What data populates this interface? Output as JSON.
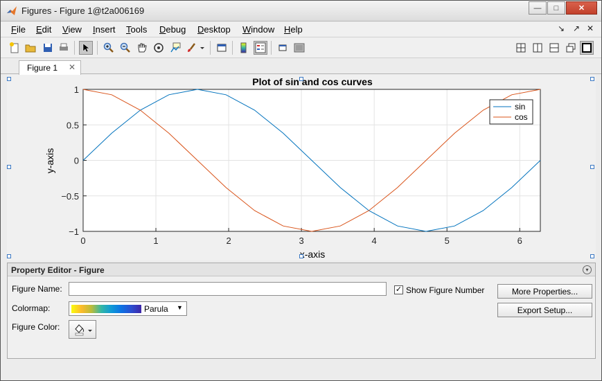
{
  "window": {
    "title": "Figures - Figure 1@t2a006169",
    "controls": {
      "minimize": "—",
      "maximize": "□",
      "close": "✕"
    }
  },
  "menu": {
    "items": [
      {
        "label": "File",
        "key": "F",
        "rest": "ile"
      },
      {
        "label": "Edit",
        "key": "E",
        "rest": "dit"
      },
      {
        "label": "View",
        "key": "V",
        "rest": "iew"
      },
      {
        "label": "Insert",
        "key": "I",
        "rest": "nsert"
      },
      {
        "label": "Tools",
        "key": "T",
        "rest": "ools"
      },
      {
        "label": "Debug",
        "key": "D",
        "rest": "ebug"
      },
      {
        "label": "Desktop",
        "key": "D",
        "rest": "esktop"
      },
      {
        "label": "Window",
        "key": "W",
        "rest": "indow"
      },
      {
        "label": "Help",
        "key": "H",
        "rest": "elp"
      }
    ],
    "right_icons": [
      "↘",
      "↗",
      "✕"
    ]
  },
  "toolbar": {
    "icons": [
      "new-figure-icon",
      "open-icon",
      "save-icon",
      "print-icon",
      "edit-plot-icon",
      "zoom-in-icon",
      "zoom-out-icon",
      "pan-icon",
      "rotate-3d-icon",
      "data-cursor-icon",
      "brush-icon",
      "link-plot-icon",
      "colorbar-icon",
      "legend-icon",
      "hide-plot-tools-icon",
      "show-plot-tools-icon",
      "tile-icon",
      "left-right-icon",
      "top-bottom-icon",
      "float-icon",
      "maximize-icon"
    ]
  },
  "tabs": [
    {
      "label": "Figure 1",
      "close": "✕"
    }
  ],
  "chart_data": {
    "type": "line",
    "title": "Plot of sin and cos curves",
    "xlabel": "x-axis",
    "ylabel": "y-axis",
    "xlim": [
      0,
      6.2832
    ],
    "ylim": [
      -1,
      1
    ],
    "xticks": [
      "0",
      "1",
      "2",
      "3",
      "4",
      "5",
      "6"
    ],
    "yticks": [
      "1",
      "0.5",
      "0",
      "−0.5",
      "−1"
    ],
    "grid": true,
    "legend": "top-right",
    "x": [
      0,
      0.3927,
      0.7854,
      1.1781,
      1.5708,
      1.9635,
      2.3562,
      2.7489,
      3.1416,
      3.5343,
      3.927,
      4.3197,
      4.7124,
      5.1051,
      5.4978,
      5.8905,
      6.2832
    ],
    "series": [
      {
        "name": "sin",
        "color": "#0072bd",
        "values": [
          0,
          0.383,
          0.707,
          0.924,
          1,
          0.924,
          0.707,
          0.383,
          0,
          -0.383,
          -0.707,
          -0.924,
          -1,
          -0.924,
          -0.707,
          -0.383,
          0
        ]
      },
      {
        "name": "cos",
        "color": "#d95319",
        "values": [
          1,
          0.924,
          0.707,
          0.383,
          0,
          -0.383,
          -0.707,
          -0.924,
          -1,
          -0.924,
          -0.707,
          -0.383,
          0,
          0.383,
          0.707,
          0.924,
          1
        ]
      }
    ]
  },
  "property_editor": {
    "title": "Property Editor - Figure",
    "collapse_icon": "▾",
    "figure_name_label": "Figure Name:",
    "figure_name_value": "",
    "show_number_label": "Show Figure Number",
    "show_number_checked": "✓",
    "colormap_label": "Colormap:",
    "colormap_value": "Parula",
    "figure_color_label": "Figure Color:",
    "more_properties": "More Properties...",
    "export_setup": "Export Setup..."
  }
}
